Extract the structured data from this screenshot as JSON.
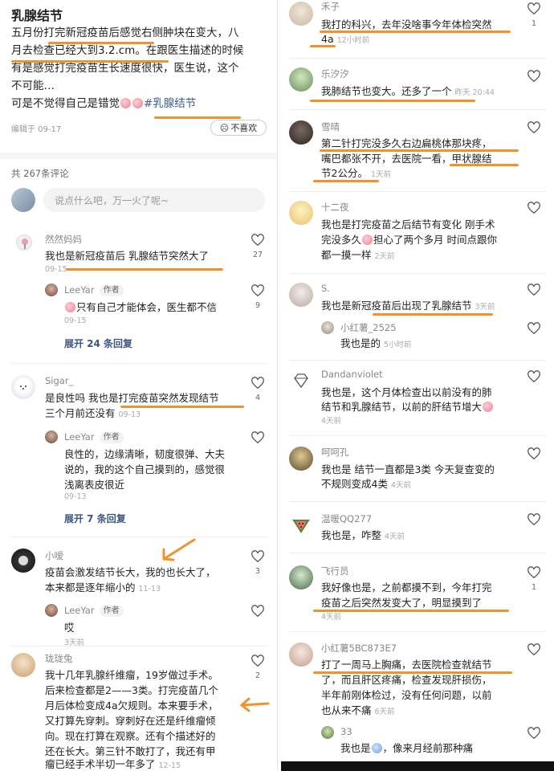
{
  "post": {
    "title": "乳腺结节",
    "body_line1": "五月份打完新冠疫苗后感觉右侧肿块在变大，八",
    "body_line2": "月去检查已经大到3.2.cm。在跟医生描述的时候",
    "body_line3": "有是感觉打完疫苗生长速度很快，医生说，这个",
    "body_line4": "不可能…",
    "body_line5_text": "可是不觉得自己是错觉",
    "hashtag": "#乳腺结节",
    "edit_date": "编辑于 09-17",
    "dislike_label": "不喜欢",
    "comment_count": "共 267条评论",
    "input_placeholder": "说点什么吧，万一火了呢~"
  },
  "left_comments": [
    {
      "name": "然然妈妈",
      "text": "我也是新冠疫苗后 乳腺结节突然大了",
      "time": "09-15",
      "likes": "27"
    },
    {
      "name": "LeeYar",
      "author_tag": "作者",
      "text": "只有自己才能体会，医生都不信",
      "time": "09-15",
      "likes": "9"
    },
    {
      "expand": "展开 24 条回复"
    },
    {
      "name": "Sigar_",
      "line1": "是良性吗 我也是打完疫苗突然发现结节",
      "line2": "三个月前还没有",
      "time": "09-13",
      "likes": "4"
    },
    {
      "name": "LeeYar",
      "author_tag": "作者",
      "line1": "良性的，边缘清晰，韧度很弹、大夫",
      "line2": "说的，我的这个自己摸到的，感觉很",
      "line3": "浅离表皮很近",
      "time": "09-13"
    },
    {
      "expand": "展开 7 条回复"
    },
    {
      "name": "小嗳",
      "line1": "疫苗会激发结节长大，我的也长大了，",
      "line2": "本来都是逐年缩小的",
      "time": "11-13",
      "likes": "3"
    },
    {
      "name": "LeeYar",
      "author_tag": "作者",
      "text": "哎",
      "time": "3天前"
    },
    {
      "name": "珑珑兔",
      "line1": "我十几年乳腺纤维瘤，19岁做过手术。",
      "line2": "后来检查都是2——3类。打完疫苗几个",
      "line3": "月后体检变成4a欠规则。本来要手术，",
      "line4": "又打算先穿刺。穿刺好在还是纤维瘤倾",
      "line5": "向。现在打算在观察。还有个描述好的",
      "line6": "还在长大。第三针不敢打了，我还有甲",
      "line7": "瘤已经手术半切一年多了",
      "time": "12-15",
      "likes": "2"
    }
  ],
  "right_comments": [
    {
      "name": "禾子",
      "line1": "我打的科兴，去年没啥事今年体检突然",
      "line2": "4a",
      "time": "12小时前",
      "likes": "1"
    },
    {
      "name": "乐汐汐",
      "text": "我肺结节也变大。还多了一个",
      "time": "昨天 20:44"
    },
    {
      "name": "雪晴",
      "line1": "第二针打完没多久右边扁桃体那块疼，",
      "line2": "嘴巴都张不开，去医院一看，甲状腺结",
      "line3": "节2公分。",
      "time": "1天前"
    },
    {
      "name": "十二夜",
      "line1": "我也是打完疫苗之后结节有变化 刚手术",
      "line2": "完没多久",
      "line2b": "担心了两个多月 时间点跟你",
      "line3": "都一摸一样",
      "time": "2天前"
    },
    {
      "name": "S.",
      "text": "我也是新冠疫苗后出现了乳腺结节",
      "time": "3天前"
    },
    {
      "name": "小红薯_2525",
      "text": "我也是的",
      "time": "5小时前"
    },
    {
      "name": "Dandanviolet",
      "line1": "我也是，这个月体检查出以前没有的肺",
      "line2": "结节和乳腺结节，以前的肝结节增大",
      "time": "4天前"
    },
    {
      "name": "呵呵孔",
      "line1": "我也是 结节一直都是3类 今天复查变的",
      "line2": "不规则变成4类",
      "time": "4天前"
    },
    {
      "name": "温暖QQ277",
      "text": "我也是，咋整",
      "time": "4天前"
    },
    {
      "name": "飞行员",
      "line1": "我好像也是，之前都摸不到，今年打完",
      "line2": "疫苗之后突然发变大了，明显摸到了",
      "time": "4天前",
      "likes": "1"
    },
    {
      "name": "小红薯5BC873E7",
      "line1": "打了一周马上胸痛，去医院检查就结节",
      "line2": "了，而且肝区疼痛，检查发现肝损伤，",
      "line3": "半年前刚体检过，没有任何问题，以前",
      "line4": "也从来不痛",
      "time": "6天前"
    },
    {
      "name": "33",
      "text_a": "我也是",
      "text_b": "，像来月经前那种痛"
    }
  ],
  "colors": {
    "accent_mark": "#f0922e",
    "link_blue": "#3d5680",
    "hashtag": "#3a5a8c"
  }
}
